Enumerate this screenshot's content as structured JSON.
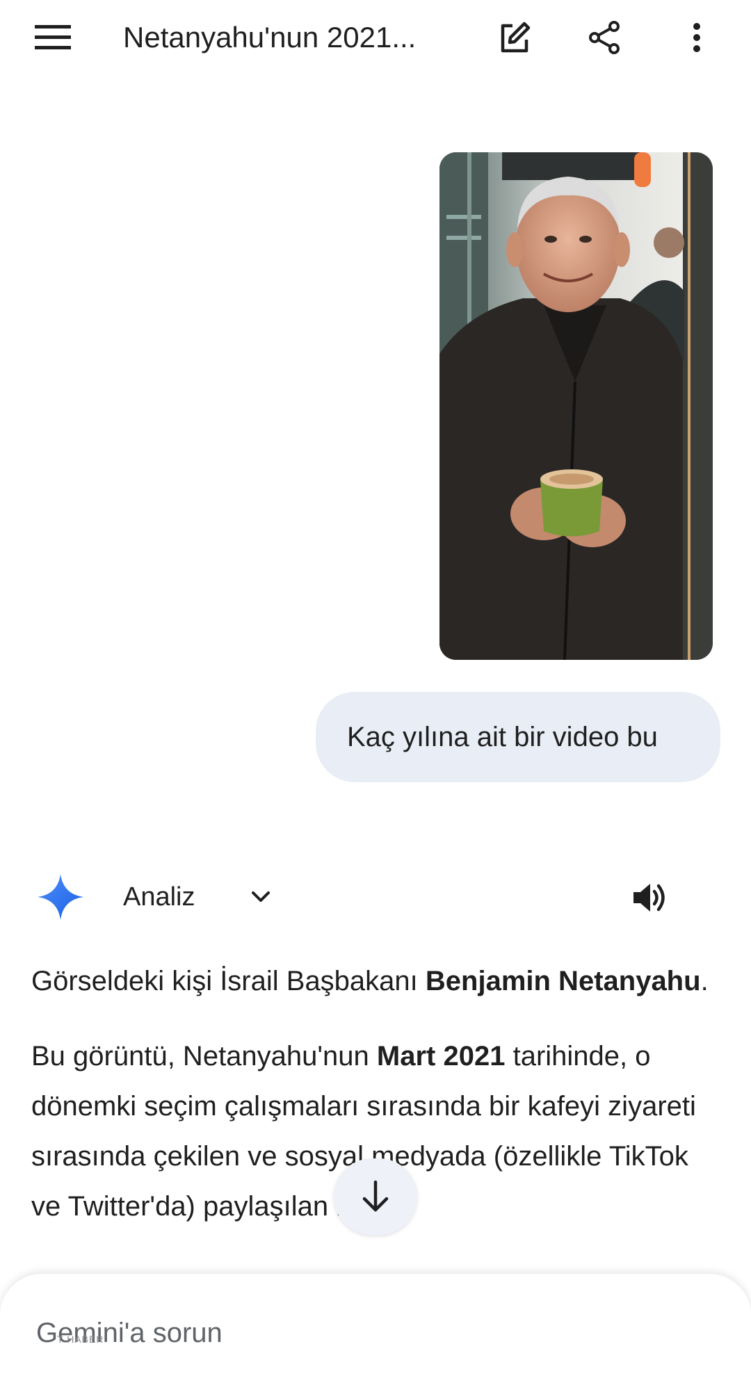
{
  "header": {
    "title": "Netanyahu'nun 2021...",
    "icons": [
      "menu-icon",
      "edit-icon",
      "share-icon",
      "more-vert-icon"
    ]
  },
  "user_message": {
    "text": "Kaç yılına ait bir video bu"
  },
  "response_header": {
    "model_label": "Analiz",
    "icons": [
      "gemini-spark-icon",
      "chevron-down-icon",
      "speaker-icon"
    ]
  },
  "response": {
    "p1_prefix": "Görseldeki kişi İsrail Başbakanı ",
    "p1_bold": "Benjamin Netanyahu",
    "p1_suffix": ".",
    "p2_prefix": "Bu görüntü, Netanyahu'nun ",
    "p2_bold": "Mart 2021",
    "p2_suffix": " tarihinde, o dönemki seçim çalışmaları sırasında bir kafeyi ziyareti sırasında çekilen ve sosyal medyada (özellikle TikTok ve Twitter'da) paylaşılan bir"
  },
  "input": {
    "placeholder": "Gemini'a sorun"
  },
  "watermark": "T HABER",
  "colors": {
    "user_bubble": "#e9eef6",
    "spark_blue": "#4285f4",
    "text": "#1f1f1f"
  }
}
